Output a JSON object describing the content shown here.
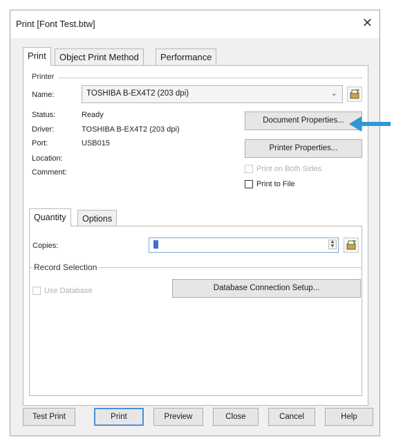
{
  "window": {
    "title": "Print [Font Test.btw]",
    "close_glyph": "✕"
  },
  "tabs": [
    {
      "label": "Print",
      "active": true
    },
    {
      "label": "Object Print Method",
      "active": false
    },
    {
      "label": "Performance",
      "active": false
    }
  ],
  "printer": {
    "group_label": "Printer",
    "name_label": "Name:",
    "name_value": "TOSHIBA B-EX4T2 (203 dpi)",
    "status_label": "Status:",
    "status_value": "Ready",
    "driver_label": "Driver:",
    "driver_value": "TOSHIBA B-EX4T2 (203 dpi)",
    "port_label": "Port:",
    "port_value": "USB015",
    "location_label": "Location:",
    "comment_label": "Comment:",
    "document_properties": "Document Properties...",
    "printer_properties": "Printer Properties...",
    "print_both_sides": "Print on Both Sides",
    "print_to_file": "Print to File"
  },
  "subtabs": [
    {
      "label": "Quantity",
      "active": true
    },
    {
      "label": "Options",
      "active": false
    }
  ],
  "quantity": {
    "copies_label": "Copies:",
    "copies_value": "",
    "record_selection_label": "Record Selection",
    "use_database": "Use Database",
    "database_setup": "Database Connection Setup..."
  },
  "footer": {
    "test_print": "Test Print",
    "print": "Print",
    "preview": "Preview",
    "close": "Close",
    "cancel": "Cancel",
    "help": "Help"
  },
  "colors": {
    "annotation_arrow": "#2f97d6",
    "focus_border": "#4a8fd8"
  }
}
